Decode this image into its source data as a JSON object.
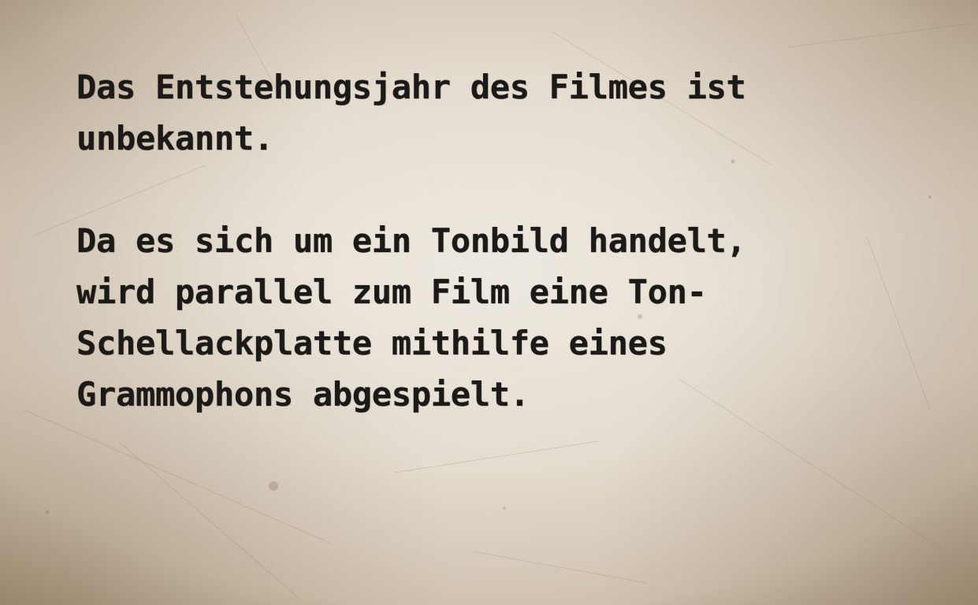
{
  "document": {
    "paragraphs": [
      {
        "lines": [
          "Das Entstehungsjahr des Filmes ist",
          "unbekannt."
        ]
      },
      {
        "lines": [
          "Da es sich um ein Tonbild handelt,",
          "wird parallel zum Film eine Ton-",
          "Schellackplatte mithilfe eines",
          "Grammophons abgespielt."
        ]
      }
    ]
  },
  "style": {
    "paper_color": "#e3dbcf",
    "ink_color": "#1c1916"
  }
}
